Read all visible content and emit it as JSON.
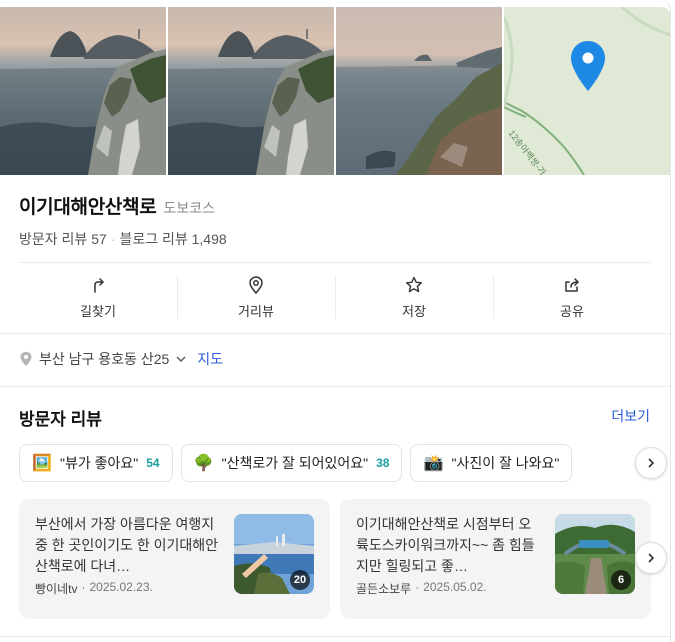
{
  "place": {
    "name": "이기대해안산책로",
    "category": "도보코스",
    "visitor_review_label": "방문자 리뷰",
    "visitor_review_count": "57",
    "blog_review_label": "블로그 리뷰",
    "blog_review_count": "1,498"
  },
  "actions": [
    {
      "label": "길찾기",
      "icon": "directions-icon"
    },
    {
      "label": "거리뷰",
      "icon": "streetview-pin-icon"
    },
    {
      "label": "저장",
      "icon": "star-icon"
    },
    {
      "label": "공유",
      "icon": "share-icon"
    }
  ],
  "address": {
    "text": "부산 남구 용호동 산25",
    "map_link": "지도"
  },
  "visitor_reviews": {
    "title": "방문자 리뷰",
    "more_label": "더보기",
    "keywords": [
      {
        "emoji": "🖼️",
        "text": "\"뷰가 좋아요\"",
        "count": "54"
      },
      {
        "emoji": "🌳",
        "text": "\"산책로가 잘 되어있어요\"",
        "count": "38"
      },
      {
        "emoji": "📸",
        "text": "\"사진이 잘 나와요\"",
        "count": ""
      }
    ],
    "items": [
      {
        "text": "부산에서 가장 아름다운 여행지 중 한 곳인이기도 한 이기대해안산책로에 다녀…",
        "author": "빵이네tv",
        "date": "2025.02.23.",
        "photo_count": "20"
      },
      {
        "text": "이기대해안산책로 시점부터 오륙도스카이워크까지~~ 좀 힘들지만 힐링되고 좋…",
        "author": "골든소보루",
        "date": "2025.05.02.",
        "photo_count": "6"
      }
    ]
  },
  "map": {
    "road_label": "12송아백쌍-가",
    "pin_color": "#1e88e5"
  }
}
